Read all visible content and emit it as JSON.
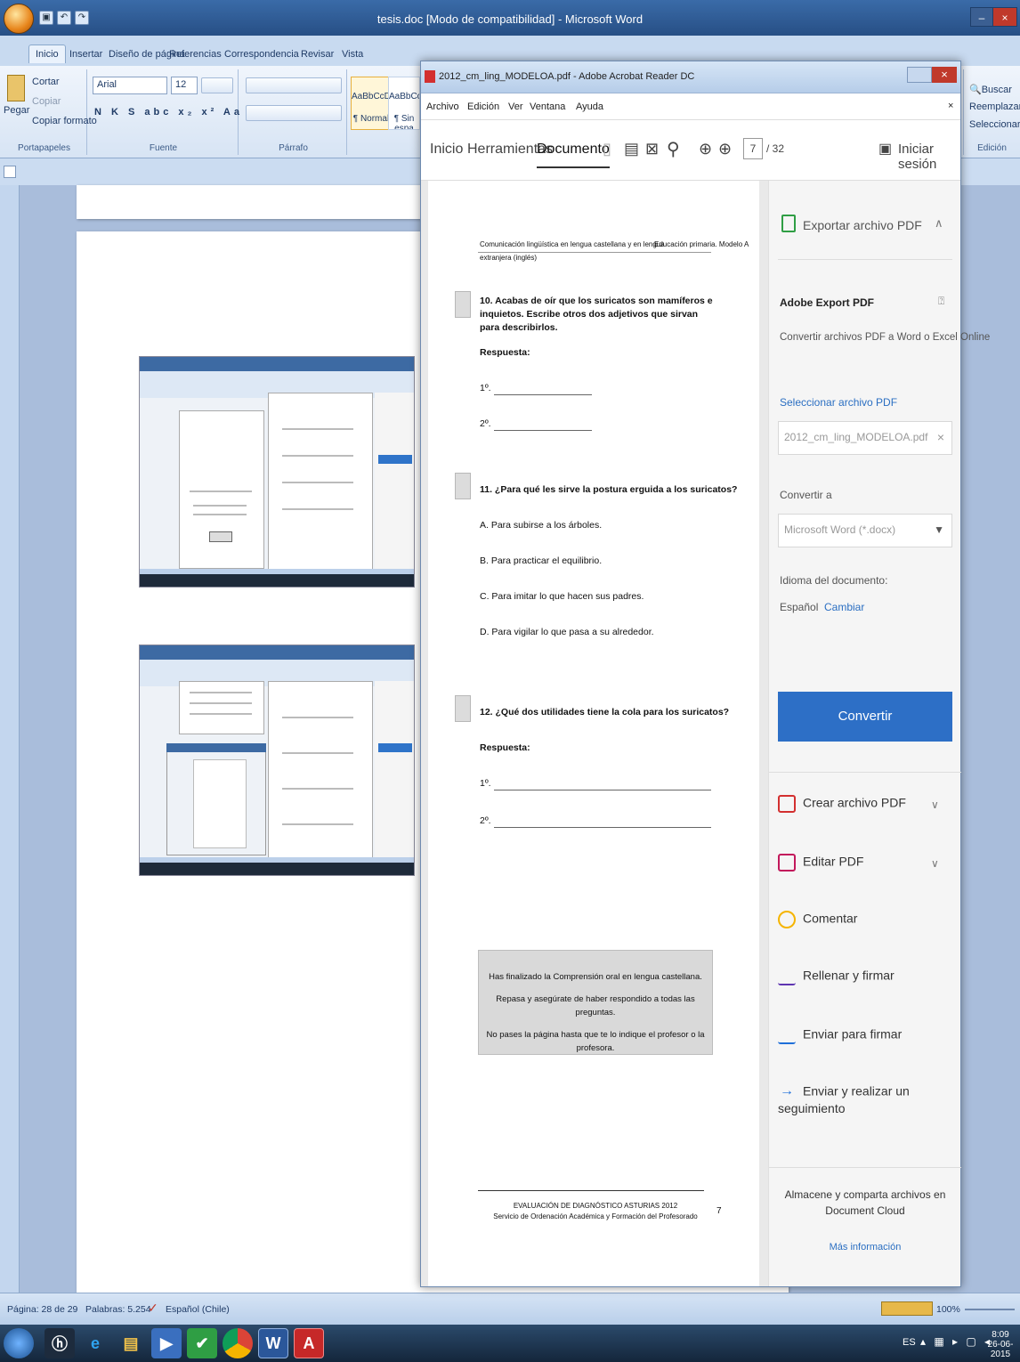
{
  "word": {
    "title": "tesis.doc [Modo de compatibilidad] - Microsoft Word",
    "tabs": [
      "Inicio",
      "Insertar",
      "Diseño de página",
      "Referencias",
      "Correspondencia",
      "Revisar",
      "Vista"
    ],
    "clipboard": {
      "paste": "Pegar",
      "cut": "Cortar",
      "copy": "Copiar",
      "format": "Copiar formato",
      "label": "Portapapeles"
    },
    "font": {
      "name": "Arial",
      "size": "12",
      "label": "Fuente"
    },
    "paragraph": {
      "label": "Párrafo"
    },
    "styles": [
      {
        "sample": "AaBbCcDc",
        "name": "¶ Normal"
      },
      {
        "sample": "AaBbCcDc",
        "name": "¶ Sin espa"
      }
    ],
    "editing": {
      "find": "Buscar",
      "replace": "Reemplazar",
      "select": "Seleccionar",
      "label": "Edición"
    },
    "status": {
      "page": "Página: 28 de 29",
      "words": "Palabras: 5.254",
      "lang": "Español (Chile)",
      "zoom": "100%"
    }
  },
  "taskbar": {
    "lang": "ES",
    "time": "8:09",
    "date": "26-06-2015"
  },
  "acrobat": {
    "title": "2012_cm_ling_MODELOA.pdf - Adobe Acrobat Reader DC",
    "menu": [
      "Archivo",
      "Edición",
      "Ver",
      "Ventana",
      "Ayuda"
    ],
    "tabs": [
      "Inicio",
      "Herramientas",
      "Documento"
    ],
    "page_current": "7",
    "page_total": "/ 32",
    "signin": "Iniciar sesión",
    "page": {
      "header_left": "Comunicación lingüística en lengua castellana y en lengua extranjera (inglés)",
      "header_right": "Educación primaria. Modelo A",
      "q10": "10. Acabas de oír que los suricatos son mamíferos e inquietos. Escribe otros dos adjetivos que sirvan para describirlos.",
      "respuesta": "Respuesta:",
      "first": "1º.",
      "second": "2º.",
      "q11": "11. ¿Para qué les sirve la postura erguida a los suricatos?",
      "q11_options": [
        "A.   Para subirse a los árboles.",
        "B.   Para practicar el equilibrio.",
        "C.   Para imitar lo que hacen sus padres.",
        "D.   Para vigilar lo que pasa a su alrededor."
      ],
      "q12": "12. ¿Qué dos utilidades tiene la cola para los suricatos?",
      "notice": [
        "Has finalizado la Comprensión oral en lengua castellana.",
        "Repasa y asegúrate de haber respondido a todas las preguntas.",
        "No pases la página hasta que te lo indique el profesor o la profesora."
      ],
      "footer1": "EVALUACIÓN DE DIAGNÓSTICO ASTURIAS 2012",
      "footer2": "Servicio de Ordenación Académica y Formación del Profesorado",
      "page_no": "7"
    },
    "panel": {
      "export_title": "Exportar archivo PDF",
      "export_sub": "Adobe Export PDF",
      "export_desc": "Convertir archivos PDF a Word o Excel Online",
      "select_file": "Seleccionar archivo PDF",
      "file_name": "2012_cm_ling_MODELOA.pdf",
      "convert_to": "Convertir a",
      "format": "Microsoft Word (*.docx)",
      "doc_lang_label": "Idioma del documento:",
      "doc_lang": "Español",
      "change": "Cambiar",
      "convert_btn": "Convertir",
      "tools": [
        "Crear archivo PDF",
        "Editar PDF",
        "Comentar",
        "Rellenar y firmar",
        "Enviar para firmar",
        "Enviar y realizar un seguimiento"
      ],
      "cloud": "Almacene y comparta archivos en Document Cloud",
      "more": "Más información"
    }
  },
  "colors": {
    "accent": "#2d6fc6",
    "word_blue": "#2b579a",
    "pdf_red": "#d32f2f"
  }
}
